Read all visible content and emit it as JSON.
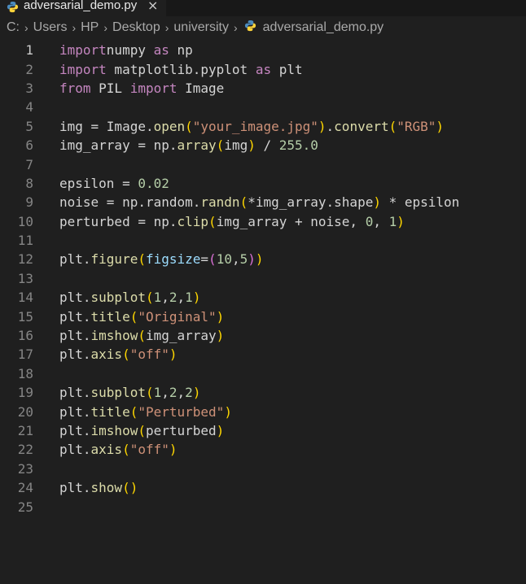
{
  "tab": {
    "filename": "adversarial_demo.py",
    "close_glyph": "×",
    "icon": "python-file-icon"
  },
  "breadcrumb": {
    "segments": [
      "C:",
      "Users",
      "HP",
      "Desktop",
      "university"
    ],
    "file": "adversarial_demo.py",
    "separator": "›"
  },
  "editor": {
    "active_line": 1,
    "lines": [
      [
        [
          "kw",
          "import"
        ],
        [
          "",
          "numpy "
        ],
        [
          "kw",
          "as"
        ],
        [
          "",
          " np"
        ]
      ],
      [
        [
          "kw",
          "import"
        ],
        [
          "",
          " matplotlib.pyplot "
        ],
        [
          "kw",
          "as"
        ],
        [
          "",
          " plt"
        ]
      ],
      [
        [
          "kw",
          "from"
        ],
        [
          "",
          " PIL "
        ],
        [
          "kw",
          "import"
        ],
        [
          "",
          " Image"
        ]
      ],
      [],
      [
        [
          "",
          "img = Image."
        ],
        [
          "fn",
          "open"
        ],
        [
          "b1",
          "("
        ],
        [
          "str",
          "\"your_image.jpg\""
        ],
        [
          "b1",
          ")"
        ],
        [
          "",
          "."
        ],
        [
          "fn",
          "convert"
        ],
        [
          "b1",
          "("
        ],
        [
          "str",
          "\"RGB\""
        ],
        [
          "b1",
          ")"
        ]
      ],
      [
        [
          "",
          "img_array = np."
        ],
        [
          "fn",
          "array"
        ],
        [
          "b1",
          "("
        ],
        [
          "",
          "img"
        ],
        [
          "b1",
          ")"
        ],
        [
          "",
          " / "
        ],
        [
          "num",
          "255.0"
        ]
      ],
      [],
      [
        [
          "",
          "epsilon = "
        ],
        [
          "num",
          "0.02"
        ]
      ],
      [
        [
          "",
          "noise = np.random."
        ],
        [
          "fn",
          "randn"
        ],
        [
          "b1",
          "("
        ],
        [
          "",
          "*img_array.shape"
        ],
        [
          "b1",
          ")"
        ],
        [
          "",
          " * epsilon"
        ]
      ],
      [
        [
          "",
          "perturbed = np."
        ],
        [
          "fn",
          "clip"
        ],
        [
          "b1",
          "("
        ],
        [
          "",
          "img_array + noise, "
        ],
        [
          "num",
          "0"
        ],
        [
          "",
          ", "
        ],
        [
          "num",
          "1"
        ],
        [
          "b1",
          ")"
        ]
      ],
      [],
      [
        [
          "",
          "plt."
        ],
        [
          "fn",
          "figure"
        ],
        [
          "b1",
          "("
        ],
        [
          "prm",
          "figsize"
        ],
        [
          "",
          "="
        ],
        [
          "b2",
          "("
        ],
        [
          "num",
          "10"
        ],
        [
          "",
          ","
        ],
        [
          "num",
          "5"
        ],
        [
          "b2",
          ")"
        ],
        [
          "b1",
          ")"
        ]
      ],
      [],
      [
        [
          "",
          "plt."
        ],
        [
          "fn",
          "subplot"
        ],
        [
          "b1",
          "("
        ],
        [
          "num",
          "1"
        ],
        [
          "",
          ","
        ],
        [
          "num",
          "2"
        ],
        [
          "",
          ","
        ],
        [
          "num",
          "1"
        ],
        [
          "b1",
          ")"
        ]
      ],
      [
        [
          "",
          "plt."
        ],
        [
          "fn",
          "title"
        ],
        [
          "b1",
          "("
        ],
        [
          "str",
          "\"Original\""
        ],
        [
          "b1",
          ")"
        ]
      ],
      [
        [
          "",
          "plt."
        ],
        [
          "fn",
          "imshow"
        ],
        [
          "b1",
          "("
        ],
        [
          "",
          "img_array"
        ],
        [
          "b1",
          ")"
        ]
      ],
      [
        [
          "",
          "plt."
        ],
        [
          "fn",
          "axis"
        ],
        [
          "b1",
          "("
        ],
        [
          "str",
          "\"off\""
        ],
        [
          "b1",
          ")"
        ]
      ],
      [],
      [
        [
          "",
          "plt."
        ],
        [
          "fn",
          "subplot"
        ],
        [
          "b1",
          "("
        ],
        [
          "num",
          "1"
        ],
        [
          "",
          ","
        ],
        [
          "num",
          "2"
        ],
        [
          "",
          ","
        ],
        [
          "num",
          "2"
        ],
        [
          "b1",
          ")"
        ]
      ],
      [
        [
          "",
          "plt."
        ],
        [
          "fn",
          "title"
        ],
        [
          "b1",
          "("
        ],
        [
          "str",
          "\"Perturbed\""
        ],
        [
          "b1",
          ")"
        ]
      ],
      [
        [
          "",
          "plt."
        ],
        [
          "fn",
          "imshow"
        ],
        [
          "b1",
          "("
        ],
        [
          "",
          "perturbed"
        ],
        [
          "b1",
          ")"
        ]
      ],
      [
        [
          "",
          "plt."
        ],
        [
          "fn",
          "axis"
        ],
        [
          "b1",
          "("
        ],
        [
          "str",
          "\"off\""
        ],
        [
          "b1",
          ")"
        ]
      ],
      [],
      [
        [
          "",
          "plt."
        ],
        [
          "fn",
          "show"
        ],
        [
          "b1",
          "()"
        ]
      ],
      []
    ]
  },
  "colors": {
    "background": "#1f1f1f",
    "keyword": "#c586c0",
    "function": "#dcdcaa",
    "string": "#ce9178",
    "number": "#b5cea8",
    "parameter": "#9cdcfe",
    "bracket_level1": "#ffd700",
    "bracket_level2": "#da70d6"
  }
}
